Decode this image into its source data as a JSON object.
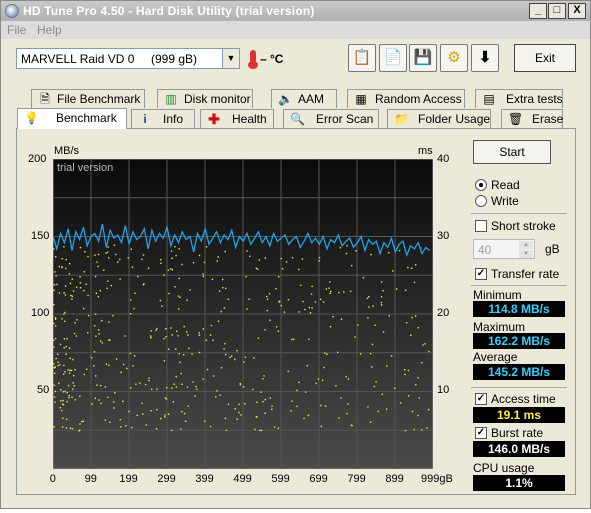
{
  "window": {
    "title": "HD Tune Pro 4.50 - Hard Disk Utility (trial version)",
    "minimize": "_",
    "maximize": "□",
    "close": "X"
  },
  "menu": {
    "file": "File",
    "help": "Help"
  },
  "toolbar": {
    "drive": "MARVELL Raid VD 0",
    "drive_size": "(999 gB)",
    "temperature": "– °C",
    "exit": "Exit",
    "icons": [
      "copy-info-icon",
      "copy-text-icon",
      "save-icon",
      "options-icon",
      "download-icon"
    ]
  },
  "tabs_top": [
    {
      "label": "File Benchmark",
      "icon": "file-benchmark-icon"
    },
    {
      "label": "Disk monitor",
      "icon": "disk-monitor-icon"
    },
    {
      "label": "AAM",
      "icon": "speaker-icon"
    },
    {
      "label": "Random Access",
      "icon": "random-access-icon"
    },
    {
      "label": "Extra tests",
      "icon": "extra-tests-icon"
    }
  ],
  "tabs_bottom": [
    {
      "label": "Benchmark",
      "icon": "bulb-icon",
      "active": true
    },
    {
      "label": "Info",
      "icon": "info-icon"
    },
    {
      "label": "Health",
      "icon": "health-cross-icon"
    },
    {
      "label": "Error Scan",
      "icon": "magnifier-icon"
    },
    {
      "label": "Folder Usage",
      "icon": "folder-icon"
    },
    {
      "label": "Erase",
      "icon": "trash-icon"
    }
  ],
  "controls": {
    "start": "Start",
    "read": "Read",
    "write": "Write",
    "mode": "read",
    "short_stroke": "Short stroke",
    "short_stroke_checked": false,
    "stroke_value": "40",
    "stroke_unit": "gB",
    "transfer_rate": "Transfer rate",
    "transfer_rate_checked": true,
    "minimum_label": "Minimum",
    "minimum": "114.8 MB/s",
    "maximum_label": "Maximum",
    "maximum": "162.2 MB/s",
    "average_label": "Average",
    "average": "145.2 MB/s",
    "access_time": "Access time",
    "access_time_checked": true,
    "access_time_value": "19.1 ms",
    "burst_rate": "Burst rate",
    "burst_rate_checked": true,
    "burst_rate_value": "146.0 MB/s",
    "cpu_usage": "CPU usage",
    "cpu_usage_value": "1.1%"
  },
  "chart_data": {
    "type": "line",
    "watermark": "trial version",
    "ylabel_left": "MB/s",
    "ylabel_right": "ms",
    "xunit": "gB",
    "x_ticks": [
      "0",
      "99",
      "199",
      "299",
      "399",
      "499",
      "599",
      "699",
      "799",
      "899",
      "999gB"
    ],
    "y_ticks_left": [
      "200",
      "150",
      "100",
      "50"
    ],
    "y_ticks_right": [
      "40",
      "30",
      "20",
      "10"
    ],
    "xlim": [
      0,
      999
    ],
    "ylim_left": [
      0,
      200
    ],
    "ylim_right": [
      0,
      40
    ],
    "grid": true,
    "series": [
      {
        "kind": "transfer-rate",
        "color": "#1fa3e8",
        "x": [
          0,
          10,
          20,
          30,
          40,
          50,
          60,
          70,
          80,
          90,
          100,
          110,
          120,
          130,
          140,
          150,
          160,
          170,
          180,
          190,
          200,
          210,
          220,
          230,
          240,
          250,
          260,
          270,
          280,
          290,
          300,
          310,
          320,
          330,
          340,
          350,
          360,
          370,
          380,
          390,
          400,
          410,
          420,
          430,
          440,
          450,
          460,
          470,
          480,
          490,
          500,
          510,
          520,
          530,
          540,
          550,
          560,
          570,
          580,
          590,
          600,
          610,
          620,
          630,
          640,
          650,
          660,
          670,
          680,
          690,
          700,
          710,
          720,
          730,
          740,
          750,
          760,
          770,
          780,
          790,
          800,
          810,
          820,
          830,
          840,
          850,
          860,
          870,
          880,
          890,
          900,
          910,
          920,
          930,
          940,
          950,
          960,
          970,
          980,
          990
        ],
        "values": [
          150,
          142,
          152,
          146,
          155,
          141,
          153,
          148,
          156,
          144,
          150,
          152,
          147,
          158,
          143,
          154,
          149,
          151,
          146,
          157,
          145,
          153,
          148,
          150,
          155,
          142,
          154,
          147,
          152,
          149,
          156,
          144,
          151,
          146,
          153,
          148,
          150,
          140,
          152,
          147,
          155,
          145,
          149,
          153,
          146,
          151,
          148,
          154,
          143,
          150,
          147,
          152,
          145,
          149,
          153,
          146,
          150,
          144,
          152,
          147,
          149,
          151,
          145,
          148,
          150,
          143,
          147,
          152,
          146,
          149,
          145,
          150,
          142,
          148,
          146,
          151,
          144,
          147,
          149,
          143,
          146,
          150,
          141,
          148,
          145,
          147,
          139,
          146,
          143,
          149,
          140,
          145,
          147,
          138,
          144,
          142,
          146,
          139,
          143,
          141
        ]
      },
      {
        "kind": "access-time",
        "color": "#e8e84a",
        "unit": "ms",
        "description": "scatter of access times, ranging mostly 5–29 ms, denser at lower x"
      }
    ]
  }
}
